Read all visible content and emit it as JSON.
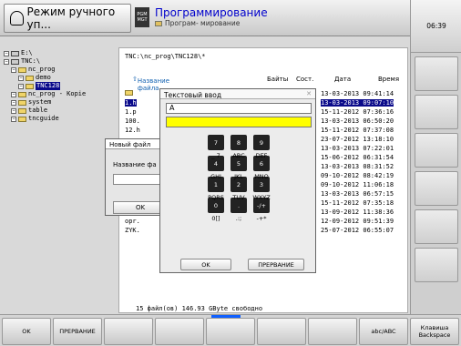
{
  "header": {
    "mode_left": "Режим ручного уп...",
    "pgm_icon_l1": "PGM",
    "pgm_icon_l2": "MGT",
    "mode_right_title": "Программирование",
    "mode_right_sub": "Програм- мирование",
    "clock": "06:39"
  },
  "tree": [
    {
      "icon": "drive",
      "label": "E:\\",
      "indent": 0,
      "selected": false
    },
    {
      "icon": "drive",
      "label": "TNC:\\",
      "indent": 0,
      "selected": false
    },
    {
      "icon": "folder",
      "label": "nc_prog",
      "indent": 1,
      "selected": false
    },
    {
      "icon": "folder",
      "label": "demo",
      "indent": 2,
      "selected": false
    },
    {
      "icon": "folder",
      "label": "TNC128",
      "indent": 2,
      "selected": true
    },
    {
      "icon": "folder",
      "label": "nc_prog - Kopie",
      "indent": 1,
      "selected": false
    },
    {
      "icon": "folder",
      "label": "system",
      "indent": 1,
      "selected": false
    },
    {
      "icon": "folder",
      "label": "table",
      "indent": 1,
      "selected": false
    },
    {
      "icon": "folder",
      "label": "tncguide",
      "indent": 1,
      "selected": false
    }
  ],
  "filelist": {
    "path": "TNC:\\nc_prog\\TNC128\\*",
    "headers": {
      "name": "Название файла",
      "bytes": "Байты",
      "state": "Сост.",
      "date": "Дата",
      "time": "Время"
    },
    "rows": [
      {
        "name": "",
        "datetime": "13-03-2013 09:41:14",
        "selected": false
      },
      {
        "name": "1.h",
        "datetime": "13-03-2013 09:07:10",
        "selected": true
      },
      {
        "name": "1.p",
        "datetime": "15-11-2012 07:36:16",
        "selected": false
      },
      {
        "name": "100.",
        "datetime": "13-03-2013 06:50:20",
        "selected": false
      },
      {
        "name": "12.h",
        "datetime": "15-11-2012 07:37:08",
        "selected": false
      },
      {
        "name": "",
        "datetime": "23-07-2012 13:18:10",
        "selected": false
      },
      {
        "name": "",
        "datetime": "13-03-2013 07:22:01",
        "selected": false
      },
      {
        "name": "",
        "datetime": "15-06-2012 06:31:54",
        "selected": false
      },
      {
        "name": "",
        "datetime": "13-03-2013 08:31:52",
        "selected": false
      },
      {
        "name": "",
        "datetime": "09-10-2012 08:42:19",
        "selected": false
      },
      {
        "name": "",
        "datetime": "09-10-2012 11:06:18",
        "selected": false
      },
      {
        "name": "",
        "datetime": "13-03-2013 06:57:15",
        "selected": false
      },
      {
        "name": "",
        "datetime": "15-11-2012 07:35:18",
        "selected": false
      },
      {
        "name": "",
        "datetime": "13-09-2012 11:38:36",
        "selected": false
      },
      {
        "name": "opr.",
        "datetime": "12-09-2012 09:51:39",
        "selected": false
      },
      {
        "name": "ZYK.",
        "datetime": "25-07-2012 06:55:07",
        "selected": false
      }
    ],
    "footer": "15  файл(ов) 146.93 GByte свободно"
  },
  "new_file_dialog": {
    "title": "Новый файл",
    "label": "Название фа",
    "ok": "OK"
  },
  "text_input_dialog": {
    "title": "Текстовый ввод",
    "close": "✕",
    "value": "A",
    "keys": [
      {
        "label": "7",
        "sub": ""
      },
      {
        "label": "8",
        "sub": ""
      },
      {
        "label": "9",
        "sub": ""
      },
      {
        "label": "4",
        "sub": ""
      },
      {
        "label": "5",
        "sub": ""
      },
      {
        "label": "6",
        "sub": ""
      },
      {
        "label": "1",
        "sub": ""
      },
      {
        "label": "2",
        "sub": ""
      },
      {
        "label": "3",
        "sub": ""
      },
      {
        "label": "0",
        "sub": ""
      },
      {
        "label": ".",
        "sub": ""
      },
      {
        "label": "-/+",
        "sub": ""
      }
    ],
    "row_labels": [
      [
        "",
        "",
        ""
      ],
      [
        "_ 7",
        "ABC",
        "DEF"
      ],
      [
        "GHI",
        "JKL",
        "MNO"
      ],
      [
        "PQRS",
        "TUV",
        "WXYZ"
      ],
      [
        "0[]",
        ".:;",
        "-+*"
      ]
    ],
    "ok": "OK",
    "cancel": "ПРЕРВАНИЕ"
  },
  "softkeys": [
    "OK",
    "ПРЕРВАНИЕ",
    "",
    "",
    "",
    "",
    "",
    "abc/ABC",
    "Клавиша Backspace"
  ]
}
